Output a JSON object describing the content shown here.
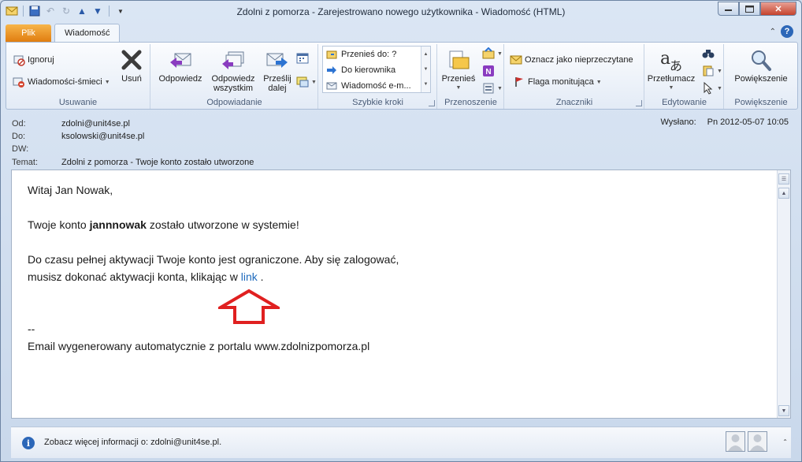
{
  "window": {
    "title": "Zdolni z pomorza - Zarejestrowano nowego użytkownika  -  Wiadomość (HTML)"
  },
  "tabs": {
    "file": "Plik",
    "message": "Wiadomość"
  },
  "ribbon": {
    "usuwanie": {
      "label": "Usuwanie",
      "ignore": "Ignoruj",
      "junk": "Wiadomości-śmieci",
      "delete": "Usuń"
    },
    "odpowiadanie": {
      "label": "Odpowiadanie",
      "reply": "Odpowiedz",
      "reply_all_1": "Odpowiedz",
      "reply_all_2": "wszystkim",
      "forward_1": "Prześlij",
      "forward_2": "dalej"
    },
    "szybkie_kroki": {
      "label": "Szybkie kroki",
      "items": [
        "Przenieś do: ?",
        "Do kierownika",
        "Wiadomość e-m..."
      ]
    },
    "przenoszenie": {
      "label": "Przenoszenie",
      "move": "Przenieś"
    },
    "znaczniki": {
      "label": "Znaczniki",
      "mark_unread": "Oznacz jako nieprzeczytane",
      "follow_up": "Flaga monitująca"
    },
    "edytowanie": {
      "label": "Edytowanie",
      "translate": "Przetłumacz"
    },
    "powiekszenie": {
      "label": "Powiększenie",
      "zoom": "Powiększenie"
    }
  },
  "header": {
    "from_label": "Od:",
    "from": "zdolni@unit4se.pl",
    "to_label": "Do:",
    "to": "ksolowski@unit4se.pl",
    "cc_label": "DW:",
    "cc": "",
    "subject_label": "Temat:",
    "subject": "Zdolni z pomorza - Twoje konto zostało utworzone",
    "sent_label": "Wysłano:",
    "sent": "Pn 2012-05-07 10:05"
  },
  "message": {
    "greeting": "Witaj Jan Nowak,",
    "line1_pre": "Twoje konto ",
    "line1_user": "jannnowak",
    "line1_post": " zostało utworzone w systemie!",
    "line2": "Do czasu pełnej aktywacji Twoje konto jest ograniczone. Aby się zalogować,",
    "line3_pre": "musisz dokonać aktywacji konta, klikając w ",
    "link": "link",
    "line3_post": " .",
    "sig_sep": "--",
    "signature": "Email wygenerowany automatycznie z portalu www.zdolnizpomorza.pl"
  },
  "people_pane": {
    "text": "Zobacz więcej informacji o: zdolni@unit4se.pl."
  },
  "colors": {
    "file_tab": "#e07d10",
    "link": "#1f6bbd",
    "annotation_arrow": "#e02020"
  }
}
